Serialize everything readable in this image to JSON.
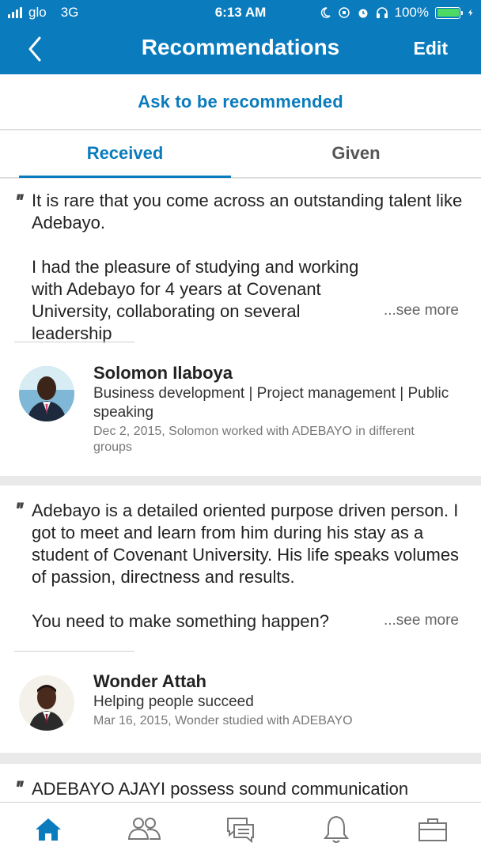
{
  "status_bar": {
    "carrier": "glo",
    "network": "3G",
    "time": "6:13 AM",
    "battery": "100%"
  },
  "nav": {
    "title": "Recommendations",
    "edit_label": "Edit"
  },
  "ask_label": "Ask to be recommended",
  "tabs": {
    "received": "Received",
    "given": "Given",
    "selected": "Received"
  },
  "recommendations": [
    {
      "quote_p1": "It is rare that you come across an outstanding talent like Adebayo.",
      "quote_p2": "I had the pleasure of studying and working with Adebayo for 4 years at Covenant University, collaborating on several leadership",
      "see_more": "...see more",
      "name": "Solomon Ilaboya",
      "headline": "Business development | Project management | Public speaking",
      "meta": "Dec 2, 2015, Solomon worked with ADEBAYO in different groups"
    },
    {
      "quote_p1": "Adebayo is a detailed oriented purpose driven person. I got to meet and learn from him during his stay as a student of Covenant University. His life speaks volumes of passion, directness and results.",
      "quote_p2": "You need to make something happen?",
      "see_more": "...see more",
      "name": "Wonder Attah",
      "headline": "Helping people succeed",
      "meta": "Mar 16, 2015, Wonder studied with ADEBAYO"
    },
    {
      "quote_p1": "ADEBAYO AJAYI possess sound communication"
    }
  ],
  "colors": {
    "brand": "#0a7bbd",
    "battery": "#4cd964"
  },
  "bottom_nav": [
    "home-icon",
    "people-icon",
    "messages-icon",
    "notifications-icon",
    "jobs-icon"
  ]
}
